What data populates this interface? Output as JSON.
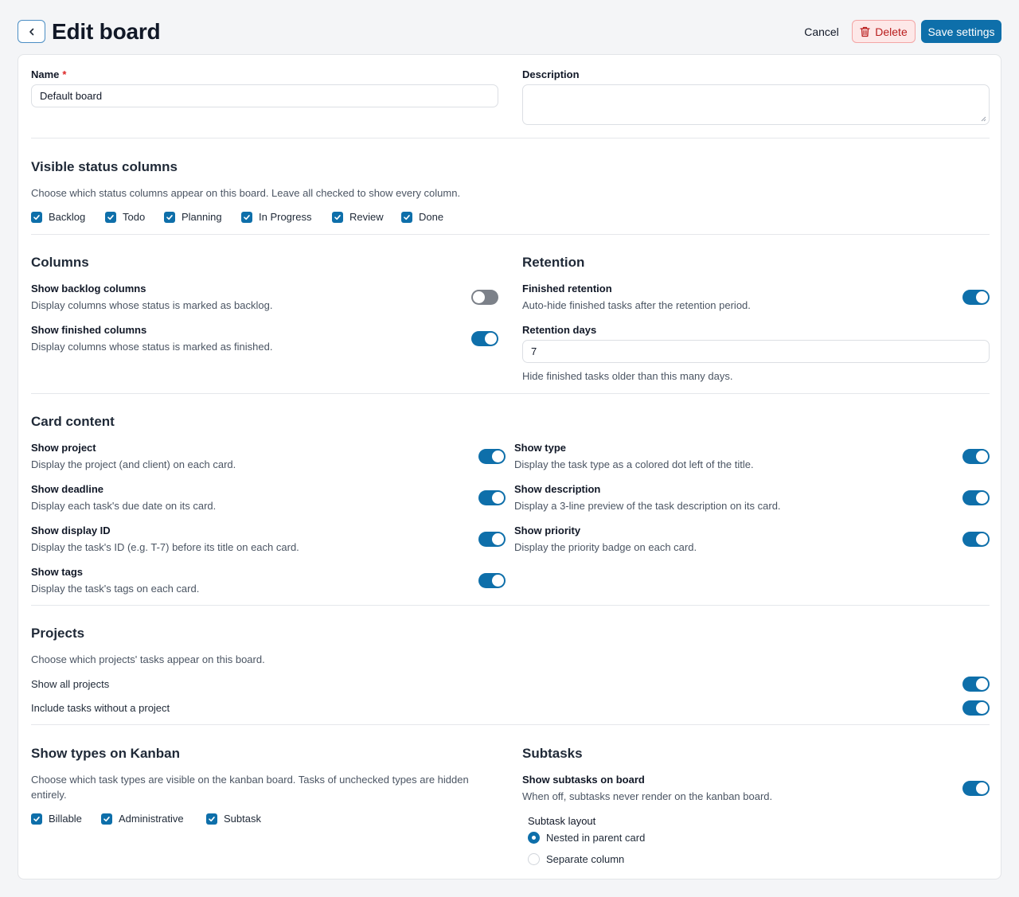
{
  "header": {
    "title": "Edit board",
    "cancel_label": "Cancel",
    "delete_label": "Delete",
    "save_label": "Save settings"
  },
  "colors": {
    "accent": "#0e6faa",
    "danger": "#b91c1c",
    "toggle_off": "#7c8189"
  },
  "form": {
    "name_label": "Name",
    "name_required_mark": "*",
    "name_value": "Default board",
    "description_label": "Description",
    "description_value": ""
  },
  "status_columns": {
    "title": "Visible status columns",
    "description": "Choose which status columns appear on this board. Leave all checked to show every column.",
    "items": [
      {
        "label": "Backlog",
        "checked": true
      },
      {
        "label": "Todo",
        "checked": true
      },
      {
        "label": "Planning",
        "checked": true
      },
      {
        "label": "In Progress",
        "checked": true
      },
      {
        "label": "Review",
        "checked": true
      },
      {
        "label": "Done",
        "checked": true
      }
    ]
  },
  "columns": {
    "title": "Columns",
    "show_backlog": {
      "label": "Show backlog columns",
      "description": "Display columns whose status is marked as backlog.",
      "on": false
    },
    "show_finished": {
      "label": "Show finished columns",
      "description": "Display columns whose status is marked as finished.",
      "on": true
    }
  },
  "retention": {
    "title": "Retention",
    "finished_retention": {
      "label": "Finished retention",
      "description": "Auto-hide finished tasks after the retention period.",
      "on": true
    },
    "days_label": "Retention days",
    "days_value": "7",
    "days_help": "Hide finished tasks older than this many days."
  },
  "card_content": {
    "title": "Card content",
    "left": [
      {
        "label": "Show project",
        "description": "Display the project (and client) on each card.",
        "on": true
      },
      {
        "label": "Show deadline",
        "description": "Display each task's due date on its card.",
        "on": true
      },
      {
        "label": "Show display ID",
        "description": "Display the task's ID (e.g. T-7) before its title on each card.",
        "on": true
      },
      {
        "label": "Show tags",
        "description": "Display the task's tags on each card.",
        "on": true
      }
    ],
    "right": [
      {
        "label": "Show type",
        "description": "Display the task type as a colored dot left of the title.",
        "on": true
      },
      {
        "label": "Show description",
        "description": "Display a 3-line preview of the task description on its card.",
        "on": true
      },
      {
        "label": "Show priority",
        "description": "Display the priority badge on each card.",
        "on": true
      }
    ]
  },
  "projects": {
    "title": "Projects",
    "description": "Choose which projects' tasks appear on this board.",
    "show_all": {
      "label": "Show all projects",
      "on": true
    },
    "include_without": {
      "label": "Include tasks without a project",
      "on": true
    }
  },
  "types": {
    "title": "Show types on Kanban",
    "description_line1": "Choose which task types are visible on the kanban board. Tasks of unchecked types are hidden",
    "description_line2": "entirely.",
    "items": [
      {
        "label": "Billable",
        "checked": true
      },
      {
        "label": "Administrative",
        "checked": true
      },
      {
        "label": "Subtask",
        "checked": true
      }
    ]
  },
  "subtasks": {
    "title": "Subtasks",
    "show_on_board": {
      "label": "Show subtasks on board",
      "description": "When off, subtasks never render on the kanban board.",
      "on": true
    },
    "layout_label": "Subtask layout",
    "layout_options": [
      {
        "label": "Nested in parent card",
        "selected": true
      },
      {
        "label": "Separate column",
        "selected": false
      }
    ]
  }
}
